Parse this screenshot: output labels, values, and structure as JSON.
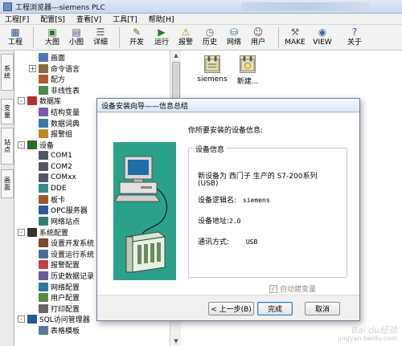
{
  "window": {
    "title": "工程浏览器---siemens PLC"
  },
  "menu": [
    "工程[F]",
    "配置[S]",
    "查看[V]",
    "工具[T]",
    "帮助[H]"
  ],
  "toolbar": [
    {
      "label": "工程",
      "icon": "project-icon"
    },
    {
      "label": "大图",
      "icon": "large-icons-icon"
    },
    {
      "label": "小图",
      "icon": "small-icons-icon"
    },
    {
      "label": "详细",
      "icon": "details-icon"
    },
    {
      "label": "开发",
      "icon": "develop-icon"
    },
    {
      "label": "运行",
      "icon": "run-icon"
    },
    {
      "label": "报警",
      "icon": "alarm-icon"
    },
    {
      "label": "历史",
      "icon": "history-icon"
    },
    {
      "label": "网络",
      "icon": "network-icon"
    },
    {
      "label": "用户",
      "icon": "user-icon"
    },
    {
      "label": "MAKE",
      "icon": "make-icon"
    },
    {
      "label": "VIEW",
      "icon": "view-icon"
    },
    {
      "label": "关于",
      "icon": "about-icon"
    }
  ],
  "side_tabs": [
    "系统",
    "变量",
    "站点",
    "画面"
  ],
  "tree": [
    {
      "label": "画面",
      "level": 2,
      "toggle": "",
      "icon": "screen-icon"
    },
    {
      "label": "命令语言",
      "level": 2,
      "toggle": "+",
      "icon": "command-language-icon"
    },
    {
      "label": "配方",
      "level": 2,
      "toggle": "",
      "icon": "recipe-icon"
    },
    {
      "label": "非线性表",
      "level": 2,
      "toggle": "",
      "icon": "nonlinear-table-icon"
    },
    {
      "label": "数据库",
      "level": 1,
      "toggle": "-",
      "icon": "database-icon"
    },
    {
      "label": "结构变量",
      "level": 2,
      "toggle": "",
      "icon": "struct-variable-icon"
    },
    {
      "label": "数据词典",
      "level": 2,
      "toggle": "",
      "icon": "data-dictionary-icon"
    },
    {
      "label": "报警组",
      "level": 2,
      "toggle": "",
      "icon": "alarm-group-icon"
    },
    {
      "label": "设备",
      "level": 1,
      "toggle": "-",
      "icon": "device-icon"
    },
    {
      "label": "COM1",
      "level": 2,
      "toggle": "",
      "icon": "com-port-icon"
    },
    {
      "label": "COM2",
      "level": 2,
      "toggle": "",
      "icon": "com-port-icon"
    },
    {
      "label": "COMxx",
      "level": 2,
      "toggle": "",
      "icon": "com-port-icon"
    },
    {
      "label": "DDE",
      "level": 2,
      "toggle": "",
      "icon": "dde-icon"
    },
    {
      "label": "板卡",
      "level": 2,
      "toggle": "",
      "icon": "board-card-icon"
    },
    {
      "label": "OPC服务器",
      "level": 2,
      "toggle": "",
      "icon": "opc-server-icon"
    },
    {
      "label": "网络站点",
      "level": 2,
      "toggle": "",
      "icon": "network-station-icon"
    },
    {
      "label": "系统配置",
      "level": 1,
      "toggle": "-",
      "icon": "system-config-icon"
    },
    {
      "label": "设置开发系统",
      "level": 2,
      "toggle": "",
      "icon": "dev-system-icon"
    },
    {
      "label": "设置运行系统",
      "level": 2,
      "toggle": "",
      "icon": "run-system-icon"
    },
    {
      "label": "报警配置",
      "level": 2,
      "toggle": "",
      "icon": "alarm-config-icon"
    },
    {
      "label": "历史数据记录",
      "level": 2,
      "toggle": "",
      "icon": "history-record-icon"
    },
    {
      "label": "网络配置",
      "level": 2,
      "toggle": "",
      "icon": "network-config-icon"
    },
    {
      "label": "用户配置",
      "level": 2,
      "toggle": "",
      "icon": "user-config-icon"
    },
    {
      "label": "打印配置",
      "level": 2,
      "toggle": "",
      "icon": "print-config-icon"
    },
    {
      "label": "SQL访问管理器",
      "level": 1,
      "toggle": "-",
      "icon": "sql-manager-icon"
    },
    {
      "label": "表格模板",
      "level": 2,
      "toggle": "",
      "icon": "table-template-icon"
    }
  ],
  "devices": [
    {
      "label": "siemens",
      "icon": "plc-device-icon"
    },
    {
      "label": "新建...",
      "icon": "new-device-icon"
    }
  ],
  "dialog": {
    "title": "设备安装向导——信息总结",
    "intro": "你所要安装的设备信息:",
    "group_label": "设备信息",
    "device_line1": "新设备为 西门子 生产的 S7-200系列",
    "device_line2": "(USB)",
    "logic_name_label": "设备逻辑名:",
    "logic_name_value": "siemens",
    "address_label": "设备地址:",
    "address_value": "2.0",
    "comm_label": "通讯方式:",
    "comm_value": "USB",
    "auto_var_label": "自动建变量",
    "auto_var_checked": true,
    "back_button": "< 上一步(B)",
    "finish_button": "完成",
    "cancel_button": "取消"
  },
  "watermark": {
    "line1": "Bai du经验",
    "line2": "jingyan.baidu.com"
  }
}
